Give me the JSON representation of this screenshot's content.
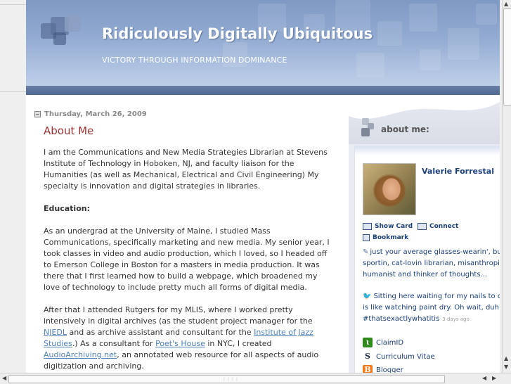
{
  "header": {
    "title": "Ridiculously Digitally Ubiquitous",
    "description": "VICTORY THROUGH INFORMATION DOMINANCE"
  },
  "post": {
    "date": "Thursday, March 26, 2009",
    "title": "About Me",
    "p1": "I am the Communications and New Media Strategies Librarian at Stevens Institute of Technology in Hoboken, NJ, and faculty liaison for the Humanities (as well as Mechanical, Electrical and Civil Engineering) My specialty is innovation and digital strategies in libraries.",
    "education_label": "Education:",
    "p2": "As an undergrad at the University of Maine, I studied Mass Communications, specifically marketing and new media. My senior year, I took classes in video and audio production, which I loved, so I headed off to Emerson College in Boston for a masters in media production. It was there that I first learned how to build a webpage, which broadened my love of technology to include pretty much all forms of digital media.",
    "p3_a": "After that I attended Rutgers for my MLIS, where I worked pretty intensively in digital archives (as the student project manager for the ",
    "link_njedl": "NJEDL",
    "p3_b": " and as archive assistant and consultant for the ",
    "link_jazz": "Institute of Jazz Studies",
    "p3_c": ".) As a consultant for ",
    "link_poets": "Poet's House",
    "p3_d": " in NYC, I created ",
    "link_audio": "AudioArchiving.net",
    "p3_e": ", an annotated web resource for all aspects of audio digitization and archiving."
  },
  "sidebar": {
    "title": "about me:",
    "profile_name": "Valerie Forrestal",
    "show_card": "Show Card",
    "connect": "Connect",
    "bookmark": "Bookmark",
    "status_note": "just your average glasses-wearin', bu",
    "status_line2": "sportin, cat-lovin librarian, misanthropic",
    "status_line3": "humanist and thinker of thoughts...",
    "tweet_line1": "Sitting here waiting for my nails to dr",
    "tweet_line2": "is like watching paint dry. Oh wait, duh...",
    "tweet_tag": "#thatsexactlywhatitis",
    "tweet_ago": "3 days ago",
    "links": [
      {
        "label": "ClaimID",
        "icon": "claimid-icon",
        "color": "#2f8a1e"
      },
      {
        "label": "Curriculum Vitae",
        "icon": "scribd-icon",
        "color": "#1b2b4a"
      },
      {
        "label": "Blogger",
        "icon": "blogger-icon",
        "color": "#f27a1a"
      }
    ]
  },
  "colors": {
    "header_blue": "#8fa8d0",
    "title_red": "#993333",
    "link_blue": "#4e7fb8",
    "profile_blue": "#1b3f7a"
  }
}
